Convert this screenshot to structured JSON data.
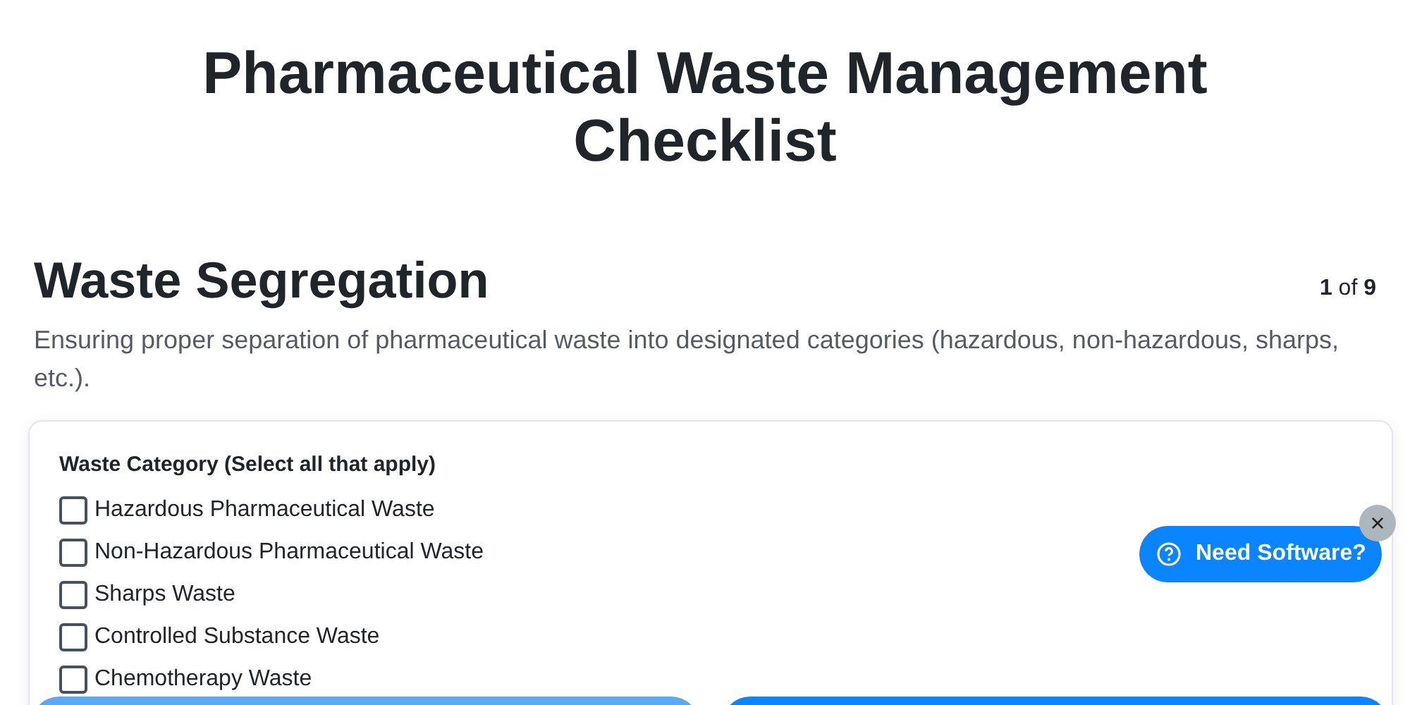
{
  "title": "Pharmaceutical Waste Management Checklist",
  "section": {
    "heading": "Waste Segregation",
    "counter": "**1** of **9**",
    "description": "Ensuring proper separation of pharmaceutical waste into designated categories (hazardous, non-hazardous, sharps, etc.)."
  },
  "question": {
    "label": "Waste Category (Select all that apply)",
    "options": [
      {
        "label": "Hazardous Pharmaceutical Waste",
        "checked": false
      },
      {
        "label": "Non-Hazardous Pharmaceutical Waste",
        "checked": false
      },
      {
        "label": "Sharps Waste",
        "checked": false
      },
      {
        "label": "Controlled Substance Waste",
        "checked": false
      },
      {
        "label": "Chemotherapy Waste",
        "checked": false
      }
    ]
  },
  "footer_buttons": [
    {
      "kind": "secondary"
    },
    {
      "kind": "primary"
    }
  ],
  "help_widget": {
    "label": "Need Software?",
    "close": "×"
  }
}
